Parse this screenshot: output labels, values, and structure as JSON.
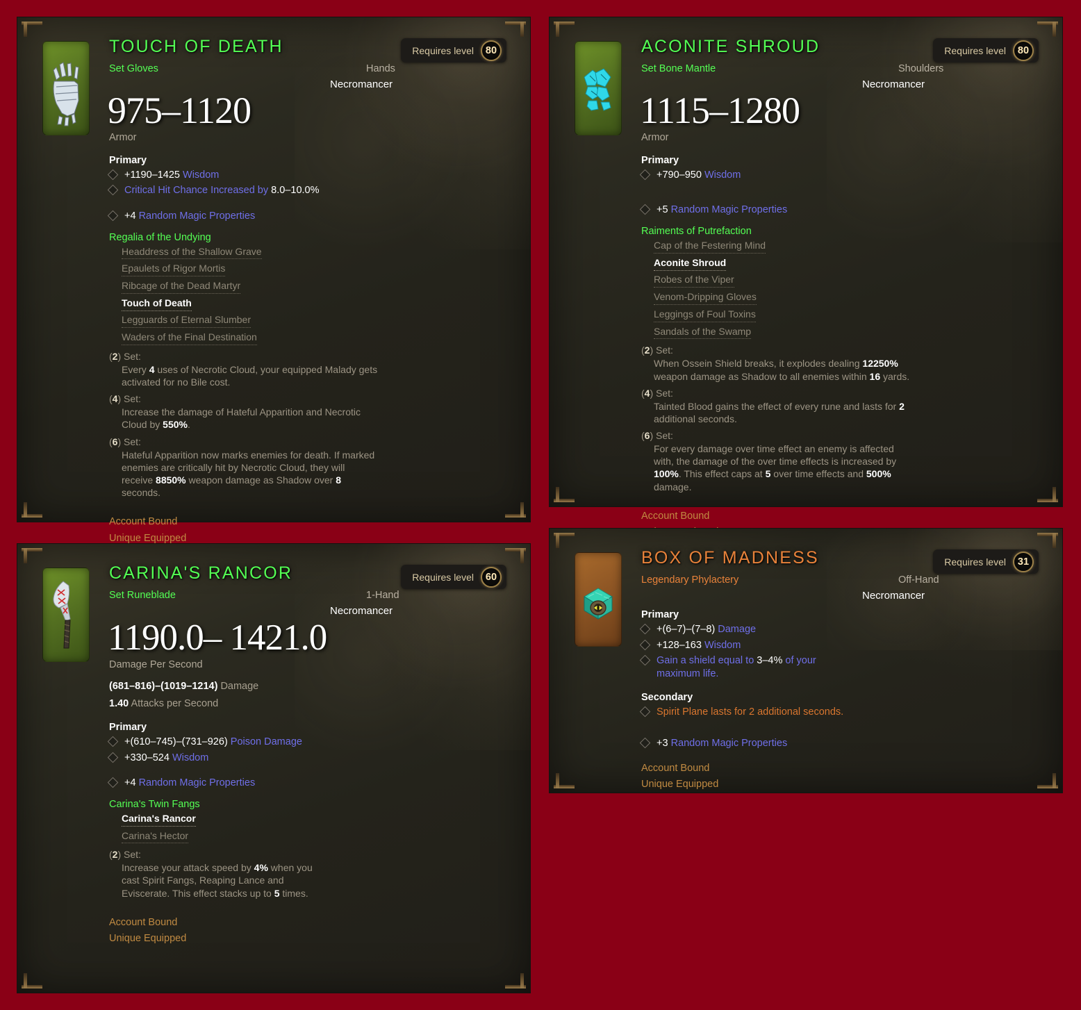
{
  "background_color": "#8a0016",
  "tooltips": [
    {
      "id": "touch-of-death",
      "title": "TOUCH OF DEATH",
      "quality": "set",
      "icon": "bone-glove-icon",
      "icon_box_color": "#597521",
      "kind": "Set Gloves",
      "slot": "Hands",
      "character_class": "Necromancer",
      "primary_value": "975–1120",
      "primary_value_label": "Armor",
      "requires_label": "Requires level",
      "requires_level": "80",
      "sections": [
        {
          "header": "Primary",
          "affixes": [
            {
              "style": "magic",
              "text": "+1190–1425 Wisdom",
              "white_prefix": "+1190–1425"
            },
            {
              "style": "magic",
              "text": "Critical Hit Chance Increased by 8.0–10.0%",
              "white_suffix": "8.0–10.0%"
            }
          ]
        }
      ],
      "random_props": "+4 Random Magic Properties",
      "random_props_count": "+4",
      "set_name": "Regalia of the Undying",
      "set_pieces": [
        {
          "name": "Headdress of the Shallow Grave",
          "owned": false
        },
        {
          "name": "Epaulets of Rigor Mortis",
          "owned": false
        },
        {
          "name": "Ribcage of the Dead Martyr",
          "owned": false
        },
        {
          "name": "Touch of Death",
          "owned": true
        },
        {
          "name": "Legguards of Eternal Slumber",
          "owned": false
        },
        {
          "name": "Waders of the Final Destination",
          "owned": false
        }
      ],
      "set_bonuses": [
        {
          "count": "2",
          "label": "Set:",
          "text": "Every 4 uses of Necrotic Cloud, your equipped Malady gets activated for no Bile cost.",
          "highlights": [
            "4"
          ]
        },
        {
          "count": "4",
          "label": "Set:",
          "text": "Increase the damage of Hateful Apparition and Necrotic Cloud by 550%.",
          "highlights": [
            "550%"
          ]
        },
        {
          "count": "6",
          "label": "Set:",
          "text": "Hateful Apparition now marks enemies for death. If marked enemies are critically hit by Necrotic Cloud, they will receive 8850% weapon damage as Shadow over 8 seconds.",
          "highlights": [
            "8850%",
            "8"
          ]
        }
      ],
      "footer": [
        "Account Bound",
        "Unique Equipped"
      ]
    },
    {
      "id": "aconite-shroud",
      "title": "ACONITE SHROUD",
      "quality": "set",
      "icon": "bone-mantle-icon",
      "icon_box_color": "#597521",
      "kind": "Set Bone Mantle",
      "slot": "Shoulders",
      "character_class": "Necromancer",
      "primary_value": "1115–1280",
      "primary_value_label": "Armor",
      "requires_label": "Requires level",
      "requires_level": "80",
      "sections": [
        {
          "header": "Primary",
          "affixes": [
            {
              "style": "magic",
              "text": "+790–950 Wisdom",
              "white_prefix": "+790–950"
            }
          ]
        }
      ],
      "random_props": "+5 Random Magic Properties",
      "random_props_count": "+5",
      "set_name": "Raiments of Putrefaction",
      "set_pieces": [
        {
          "name": "Cap of the Festering Mind",
          "owned": false
        },
        {
          "name": "Aconite Shroud",
          "owned": true
        },
        {
          "name": "Robes of the Viper",
          "owned": false
        },
        {
          "name": "Venom-Dripping Gloves",
          "owned": false
        },
        {
          "name": "Leggings of Foul Toxins",
          "owned": false
        },
        {
          "name": "Sandals of the Swamp",
          "owned": false
        }
      ],
      "set_bonuses": [
        {
          "count": "2",
          "label": "Set:",
          "text": "When Ossein Shield breaks, it explodes dealing 12250% weapon damage as Shadow to all enemies within 16 yards.",
          "highlights": [
            "12250%",
            "16"
          ]
        },
        {
          "count": "4",
          "label": "Set:",
          "text": "Tainted Blood gains the effect of every rune and lasts for 2 additional seconds.",
          "highlights": [
            "2"
          ]
        },
        {
          "count": "6",
          "label": "Set:",
          "text": "For every damage over time effect an enemy is affected with, the damage of the over time effects is increased by 100%. This effect caps at 5 over time effects and 500% damage.",
          "highlights": [
            "100%",
            "5",
            "500%"
          ]
        }
      ],
      "footer": [
        "Account Bound",
        "Unique Equipped"
      ]
    },
    {
      "id": "carinas-rancor",
      "title": "CARINA'S RANCOR",
      "quality": "set",
      "icon": "runeblade-scythe-icon",
      "icon_box_color": "#597521",
      "kind": "Set Runeblade",
      "slot": "1-Hand",
      "character_class": "Necromancer",
      "primary_value": "1190.0– 1421.0",
      "primary_value_label": "Damage Per Second",
      "requires_label": "Requires level",
      "requires_level": "60",
      "weapon_lines": [
        {
          "value": "(681–816)–(1019–1214)",
          "label": "Damage"
        },
        {
          "value": "1.40",
          "label": "Attacks per Second"
        }
      ],
      "sections": [
        {
          "header": "Primary",
          "affixes": [
            {
              "style": "magic",
              "text": "+(610–745)–(731–926) Poison Damage",
              "white_prefix": "+(610–745)–(731–926)"
            },
            {
              "style": "magic",
              "text": "+330–524 Wisdom",
              "white_prefix": "+330–524"
            }
          ]
        }
      ],
      "random_props": "+4 Random Magic Properties",
      "random_props_count": "+4",
      "set_name": "Carina's Twin Fangs",
      "set_pieces": [
        {
          "name": "Carina's Rancor",
          "owned": true
        },
        {
          "name": "Carina's Hector",
          "owned": false
        }
      ],
      "set_bonuses": [
        {
          "count": "2",
          "label": "Set:",
          "text": "Increase your attack speed by 4% when you cast Spirit Fangs, Reaping Lance and Eviscerate. This effect stacks up to 5 times.",
          "highlights": [
            "4%",
            "5"
          ]
        }
      ],
      "footer": [
        "Account Bound",
        "Unique Equipped"
      ]
    },
    {
      "id": "box-of-madness",
      "title": "BOX OF MADNESS",
      "quality": "legendary",
      "icon": "phylactery-box-icon",
      "icon_box_color": "#8d5524",
      "kind": "Legendary Phylactery",
      "slot": "Off-Hand",
      "character_class": "Necromancer",
      "primary_value": "",
      "primary_value_label": "",
      "requires_label": "Requires level",
      "requires_level": "31",
      "sections": [
        {
          "header": "Primary",
          "affixes": [
            {
              "style": "magic",
              "text": "+(6–7)–(7–8) Damage",
              "white_prefix": "+(6–7)–(7–8)"
            },
            {
              "style": "magic",
              "text": "+128–163 Wisdom",
              "white_prefix": "+128–163"
            },
            {
              "style": "magic",
              "text": "Gain a shield equal to 3–4% of your maximum life.",
              "white_suffix": "3–4%"
            }
          ]
        },
        {
          "header": "Secondary",
          "affixes": [
            {
              "style": "legend",
              "text": "Spirit Plane lasts for 2 additional seconds."
            }
          ]
        }
      ],
      "random_props": "+3 Random Magic Properties",
      "random_props_count": "+3",
      "footer": [
        "Account Bound",
        "Unique Equipped"
      ]
    }
  ]
}
